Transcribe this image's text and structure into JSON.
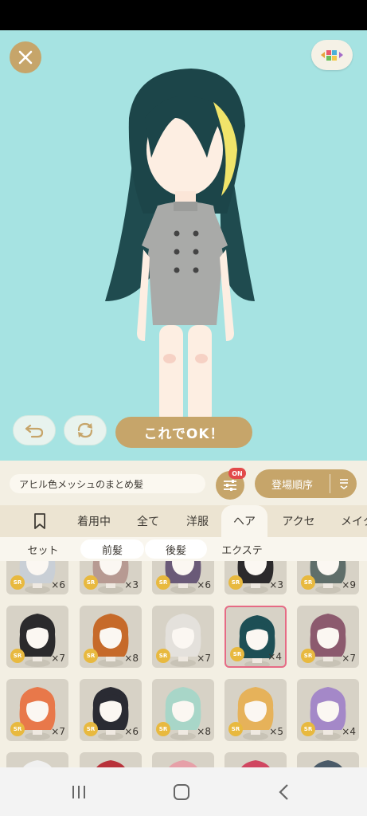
{
  "ok_button": "これでOK！",
  "item_name": "アヒル色メッシュのまとめ髪",
  "filter_badge": "ON",
  "sort_label": "登場順序",
  "tabs": [
    {
      "label": ""
    },
    {
      "label": "着用中"
    },
    {
      "label": "全て"
    },
    {
      "label": "洋服"
    },
    {
      "label": "ヘア"
    },
    {
      "label": "アクセ"
    },
    {
      "label": "メイク"
    }
  ],
  "subtabs": [
    {
      "label": "セット"
    },
    {
      "label": "前髪"
    },
    {
      "label": "後髪"
    },
    {
      "label": "エクステ"
    }
  ],
  "rarity_label": "SR",
  "items": [
    {
      "count": "×6",
      "hair_color": "#c9cfd6"
    },
    {
      "count": "×3",
      "hair_color": "#b79a92"
    },
    {
      "count": "×6",
      "hair_color": "#6a5a78"
    },
    {
      "count": "×3",
      "hair_color": "#2c2a2c"
    },
    {
      "count": "×9",
      "hair_color": "#5f6e6a"
    },
    {
      "count": "×7",
      "hair_color": "#2b2a2c"
    },
    {
      "count": "×8",
      "hair_color": "#c66a2a"
    },
    {
      "count": "×7",
      "hair_color": "#e4e1dc"
    },
    {
      "count": "×4",
      "hair_color": "#1d4f55",
      "selected": true
    },
    {
      "count": "×7",
      "hair_color": "#8c5a6e"
    },
    {
      "count": "×7",
      "hair_color": "#e8784a"
    },
    {
      "count": "×6",
      "hair_color": "#2a2b33"
    },
    {
      "count": "×8",
      "hair_color": "#a8d6c8"
    },
    {
      "count": "×5",
      "hair_color": "#e6b25a"
    },
    {
      "count": "×4",
      "hair_color": "#a488c8"
    },
    {
      "count": "",
      "hair_color": "#f0f0f0"
    },
    {
      "count": "",
      "hair_color": "#b8323a"
    },
    {
      "count": "",
      "hair_color": "#e6a0a8"
    },
    {
      "count": "",
      "hair_color": "#d04660"
    },
    {
      "count": "",
      "hair_color": "#4a5a68"
    }
  ],
  "colors": {
    "stage_bg": "#a6e3e2",
    "accent_gold": "#c6a56a",
    "panel_bg": "#f3efe3",
    "selected_border": "#e66b85",
    "rarity_badge": "#e8b93f"
  },
  "icons": {
    "close": "close-icon",
    "palette": "palette-icon",
    "undo": "undo-icon",
    "refresh": "refresh-icon",
    "filter": "filter-sliders-icon",
    "sort": "sort-icon",
    "bookmark": "bookmark-icon"
  }
}
